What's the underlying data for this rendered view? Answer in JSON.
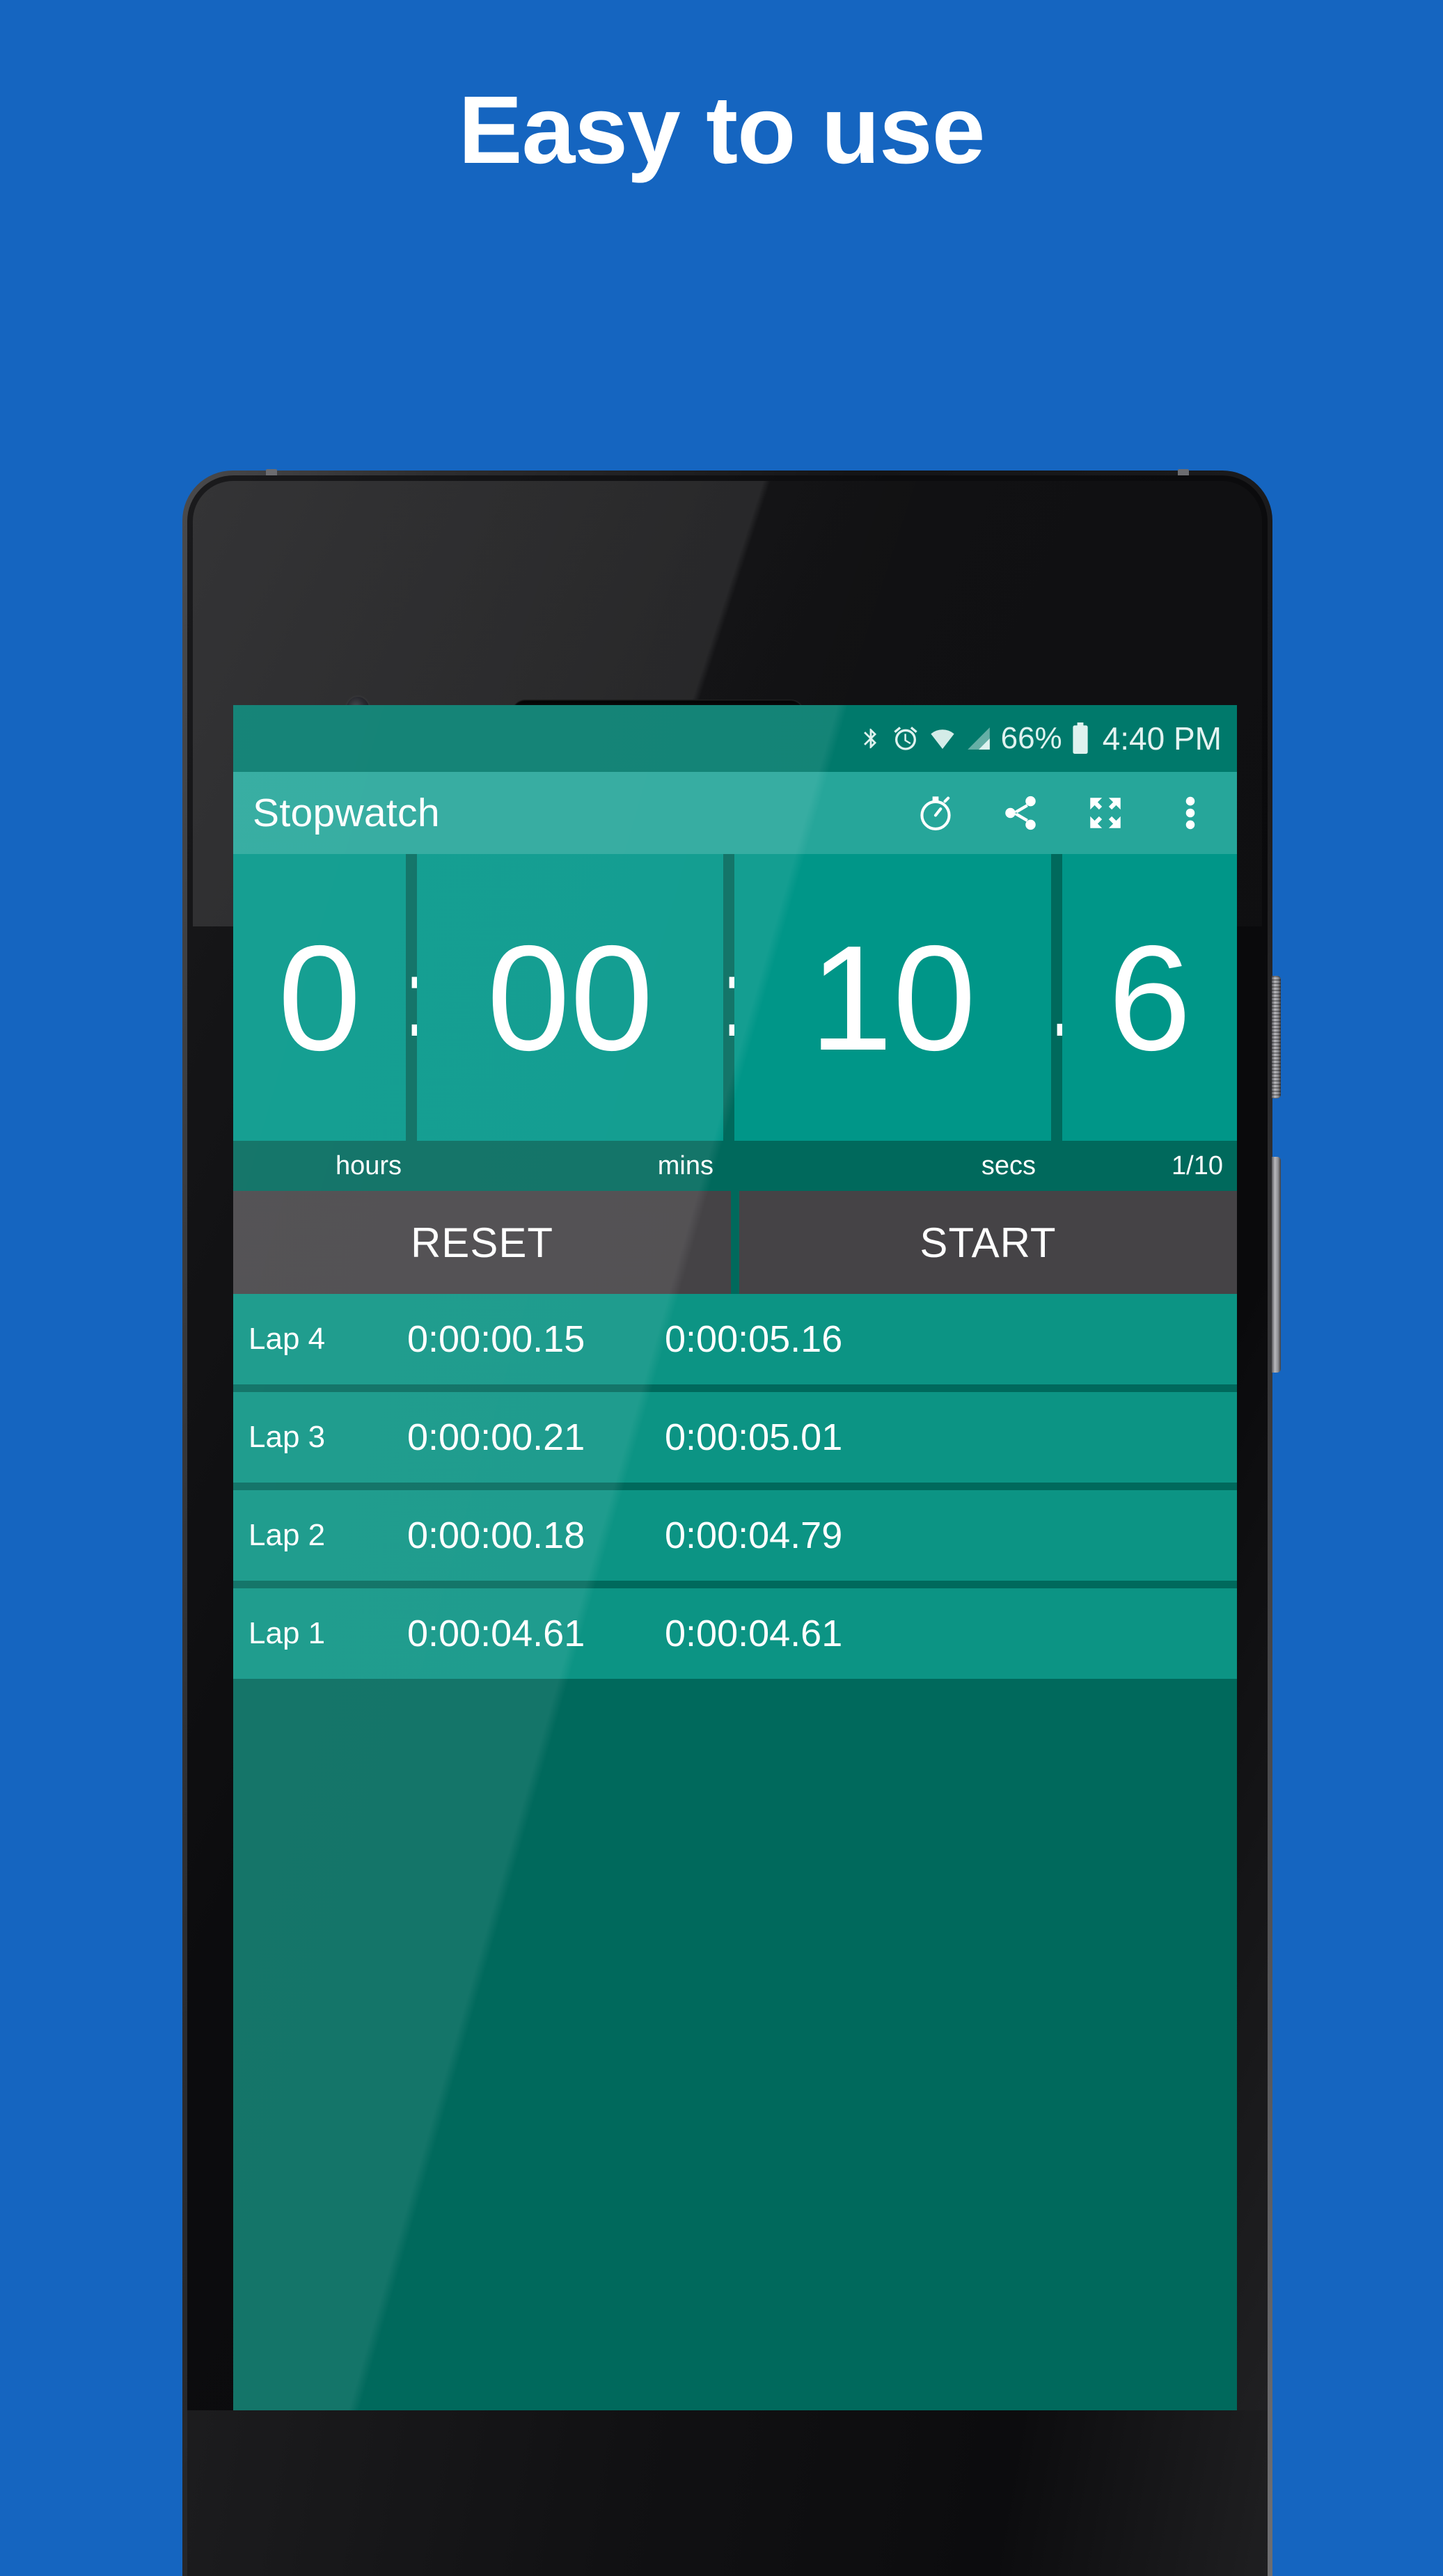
{
  "promo": {
    "headline": "Easy to use",
    "background_color": "#1565C0"
  },
  "theme": {
    "primary": "#26A69A",
    "primary_dark": "#00796B",
    "accent": "#009688",
    "surface_dark": "#00695C",
    "button_gray": "#454346",
    "lap_row": "#0C9484",
    "text_on_primary": "#FFFFFF"
  },
  "status_bar": {
    "icons": [
      "bluetooth-icon",
      "alarm-icon",
      "wifi-icon",
      "signal-icon",
      "battery-icon"
    ],
    "battery_percent": "66%",
    "time": "4:40 PM"
  },
  "app_bar": {
    "title": "Stopwatch",
    "actions": [
      {
        "name": "lap-icon",
        "label": "Lap"
      },
      {
        "name": "share-icon",
        "label": "Share"
      },
      {
        "name": "fullscreen-icon",
        "label": "Fullscreen"
      },
      {
        "name": "overflow-menu-icon",
        "label": "More options"
      }
    ]
  },
  "timer": {
    "hours": "0",
    "separator_1": ":",
    "minutes": "00",
    "separator_2": ":",
    "seconds": "10",
    "separator_3": ".",
    "tenths": "6",
    "unit_hours": "hours",
    "unit_mins": "mins",
    "unit_secs": "secs",
    "unit_tenths": "1/10",
    "elapsed_display": "0:00:10.6"
  },
  "controls": {
    "reset_label": "RESET",
    "start_label": "START"
  },
  "laps": [
    {
      "name": "Lap 4",
      "split": "0:00:00.15",
      "total": "0:00:05.16"
    },
    {
      "name": "Lap 3",
      "split": "0:00:00.21",
      "total": "0:00:05.01"
    },
    {
      "name": "Lap 2",
      "split": "0:00:00.18",
      "total": "0:00:04.79"
    },
    {
      "name": "Lap 1",
      "split": "0:00:04.61",
      "total": "0:00:04.61"
    }
  ]
}
